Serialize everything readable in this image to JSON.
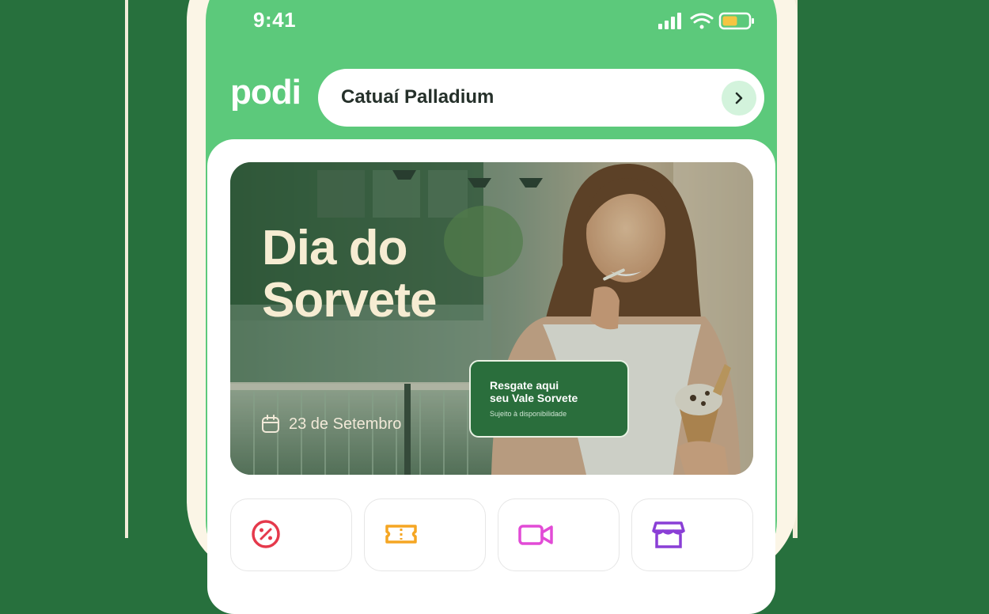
{
  "status_bar": {
    "time": "9:41"
  },
  "header": {
    "logo_text": "podi",
    "location": "Catuaí Palladium"
  },
  "banner": {
    "title": "Dia do\nSorvete",
    "date": "23 de Setembro",
    "redeem_card": {
      "title": "Resgate aqui\nseu Vale Sorvete",
      "subtitle": "Sujeito à disponibilidade"
    }
  },
  "shortcuts": [
    {
      "icon": "discount-icon",
      "color": "#e5394b"
    },
    {
      "icon": "ticket-icon",
      "color": "#f5a623"
    },
    {
      "icon": "video-icon",
      "color": "#e24bd6"
    },
    {
      "icon": "store-icon",
      "color": "#8a3fd6"
    }
  ],
  "colors": {
    "background": "#27703d",
    "header_green": "#5cc97b",
    "frame_cream": "#fbf5e6",
    "card_green": "#2a6e3c",
    "banner_title": "#f6ecd2"
  }
}
